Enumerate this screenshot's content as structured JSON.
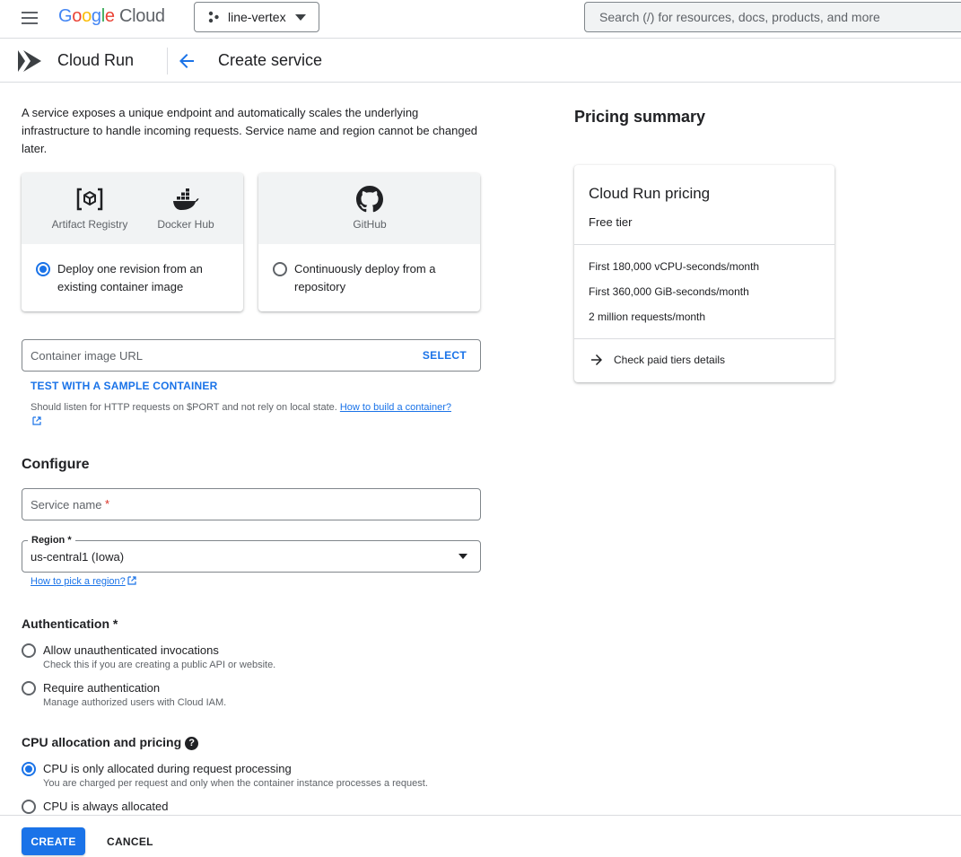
{
  "header": {
    "logo_google": [
      "G",
      "o",
      "o",
      "g",
      "l",
      "e"
    ],
    "logo_cloud": "Cloud",
    "project": "line-vertex",
    "search_placeholder": "Search (/) for resources, docs, products, and more"
  },
  "subheader": {
    "product": "Cloud Run",
    "title": "Create service"
  },
  "intro": "A service exposes a unique endpoint and automatically scales the underlying infrastructure to handle incoming requests. Service name and region cannot be changed later.",
  "source_cards": [
    {
      "sources": [
        "Artifact Registry",
        "Docker Hub"
      ],
      "option": "Deploy one revision from an existing container image",
      "selected": true
    },
    {
      "sources": [
        "GitHub"
      ],
      "option": "Continuously deploy from a repository",
      "selected": false
    }
  ],
  "container": {
    "placeholder": "Container image URL",
    "select_label": "SELECT",
    "sample_label": "TEST WITH A SAMPLE CONTAINER",
    "hint": "Should listen for HTTP requests on $PORT and not rely on local state.",
    "hint_link": "How to build a container?"
  },
  "configure": {
    "heading": "Configure",
    "service_name_placeholder": "Service name",
    "required_mark": "*",
    "region_label": "Region *",
    "region_value": "us-central1 (Iowa)",
    "region_link": "How to pick a region?"
  },
  "authentication": {
    "heading": "Authentication *",
    "options": [
      {
        "label": "Allow unauthenticated invocations",
        "desc": "Check this if you are creating a public API or website.",
        "selected": false
      },
      {
        "label": "Require authentication",
        "desc": "Manage authorized users with Cloud IAM.",
        "selected": false
      }
    ]
  },
  "cpu": {
    "heading": "CPU allocation and pricing",
    "help_glyph": "?",
    "options": [
      {
        "label": "CPU is only allocated during request processing",
        "desc": "You are charged per request and only when the container instance processes a request.",
        "selected": true
      },
      {
        "label": "CPU is always allocated",
        "selected": false
      }
    ]
  },
  "pricing": {
    "heading": "Pricing summary",
    "card_title": "Cloud Run pricing",
    "tier": "Free tier",
    "items": [
      "First 180,000 vCPU-seconds/month",
      "First 360,000 GiB-seconds/month",
      "2 million requests/month"
    ],
    "link": "Check paid tiers details"
  },
  "footer": {
    "create": "CREATE",
    "cancel": "CANCEL"
  },
  "colors": {
    "accent": "#1a73e8",
    "border": "#dadce0",
    "required": "#d93025"
  }
}
